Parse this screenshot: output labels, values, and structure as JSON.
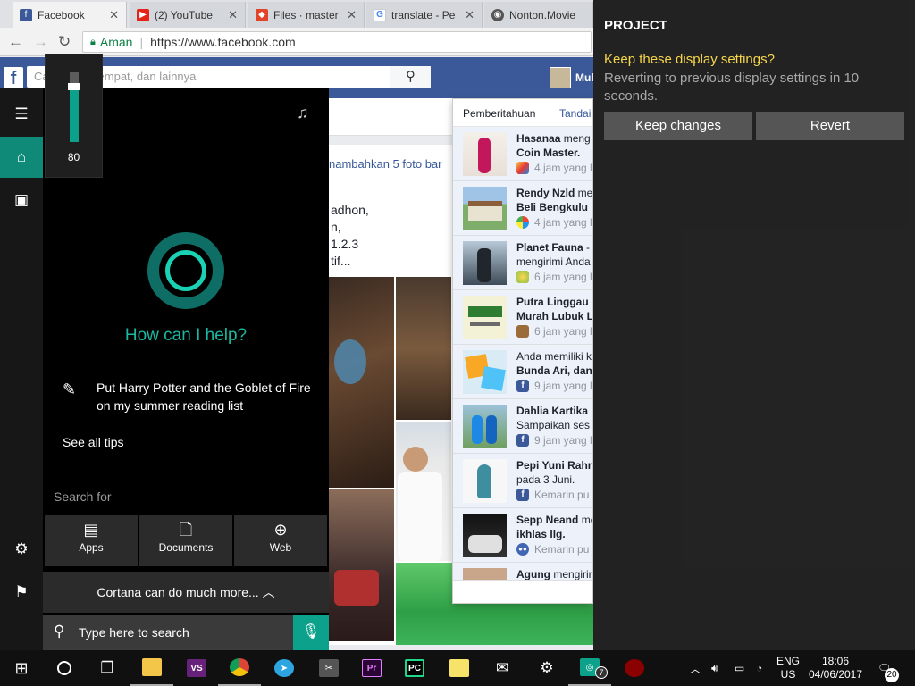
{
  "browser": {
    "tabs": [
      {
        "title": "Facebook",
        "icon": "facebook-icon",
        "active": true
      },
      {
        "title": "(2) YouTube",
        "icon": "youtube-icon",
        "active": false
      },
      {
        "title": "Files · master",
        "icon": "gitlab-icon",
        "active": false
      },
      {
        "title": "translate - Pe",
        "icon": "google-icon",
        "active": false
      },
      {
        "title": "Nonton.Movie",
        "icon": "film-icon",
        "active": false
      }
    ],
    "security_label": "Aman",
    "url": "https://www.facebook.com"
  },
  "facebook": {
    "search_placeholder": "Cari orang, tempat, dan lainnya",
    "user_name": "Mul",
    "post_link": "nambahkan 5 foto bar",
    "post_lines": [
      "adhon,",
      "n,",
      "1.2.3",
      "tif..."
    ],
    "notifications": {
      "title": "Pemberitahuan",
      "mark_all": "Tandai",
      "items": [
        {
          "line1_bold": "Hasanaa",
          "line1_rest": " meng",
          "line2": "Coin Master.",
          "line2_bold": true,
          "time": "4 jam yang l"
        },
        {
          "line1_bold": "Rendy Nzld",
          "line1_rest": " me",
          "line2": "Beli Bengkulu (",
          "line2_bold": true,
          "time": "4 jam yang l"
        },
        {
          "line1_bold": "Planet Fauna",
          "line1_rest": " - ",
          "line2": "mengirimi Anda",
          "line2_bold": false,
          "time": "6 jam yang l"
        },
        {
          "line1_bold": "Putra Linggau",
          "line1_rest": " n",
          "line2": "Murah Lubuk Li",
          "line2_bold": true,
          "time": "6 jam yang l"
        },
        {
          "line1_bold": "",
          "line1_rest": "Anda memiliki k",
          "line2": "Bunda Ari, dan",
          "line2_bold": true,
          "time": "9 jam yang l"
        },
        {
          "line1_bold": "Dahlia Kartika",
          "line1_rest": " ",
          "line2": "Sampaikan ses",
          "line2_bold": false,
          "time": "9 jam yang l"
        },
        {
          "line1_bold": "Pepi Yuni Rahm",
          "line1_rest": "",
          "line2": "pada 3 Juni.",
          "line2_bold": false,
          "time": "Kemarin pu"
        },
        {
          "line1_bold": "Sepp Neand",
          "line1_rest": " me",
          "line2": "ikhlas llg.",
          "line2_bold": true,
          "time": "Kemarin pu"
        },
        {
          "line1_bold": "Agung",
          "line1_rest": " mengirin",
          "line2": "",
          "line2_bold": false,
          "time": ""
        }
      ]
    }
  },
  "volume": {
    "level": 80,
    "label": "80"
  },
  "cortana": {
    "question": "How can I help?",
    "tip": "Put Harry Potter and the Goblet of Fire on my summer reading list",
    "see_all_tips": "See all tips",
    "search_for": "Search for",
    "buttons": [
      {
        "label": "Apps",
        "icon": "apps-icon"
      },
      {
        "label": "Documents",
        "icon": "document-icon"
      },
      {
        "label": "Web",
        "icon": "globe-icon"
      }
    ],
    "more": "Cortana can do much more...",
    "search_placeholder": "Type here to search"
  },
  "project": {
    "title": "PROJECT",
    "question": "Keep these display settings?",
    "message": "Reverting to previous display settings in 10 seconds.",
    "keep": "Keep changes",
    "revert": "Revert"
  },
  "taskbar": {
    "lang": "ENG",
    "region": "US",
    "time": "18:06",
    "date": "04/06/2017",
    "notification_count": "20",
    "badge": "7"
  }
}
